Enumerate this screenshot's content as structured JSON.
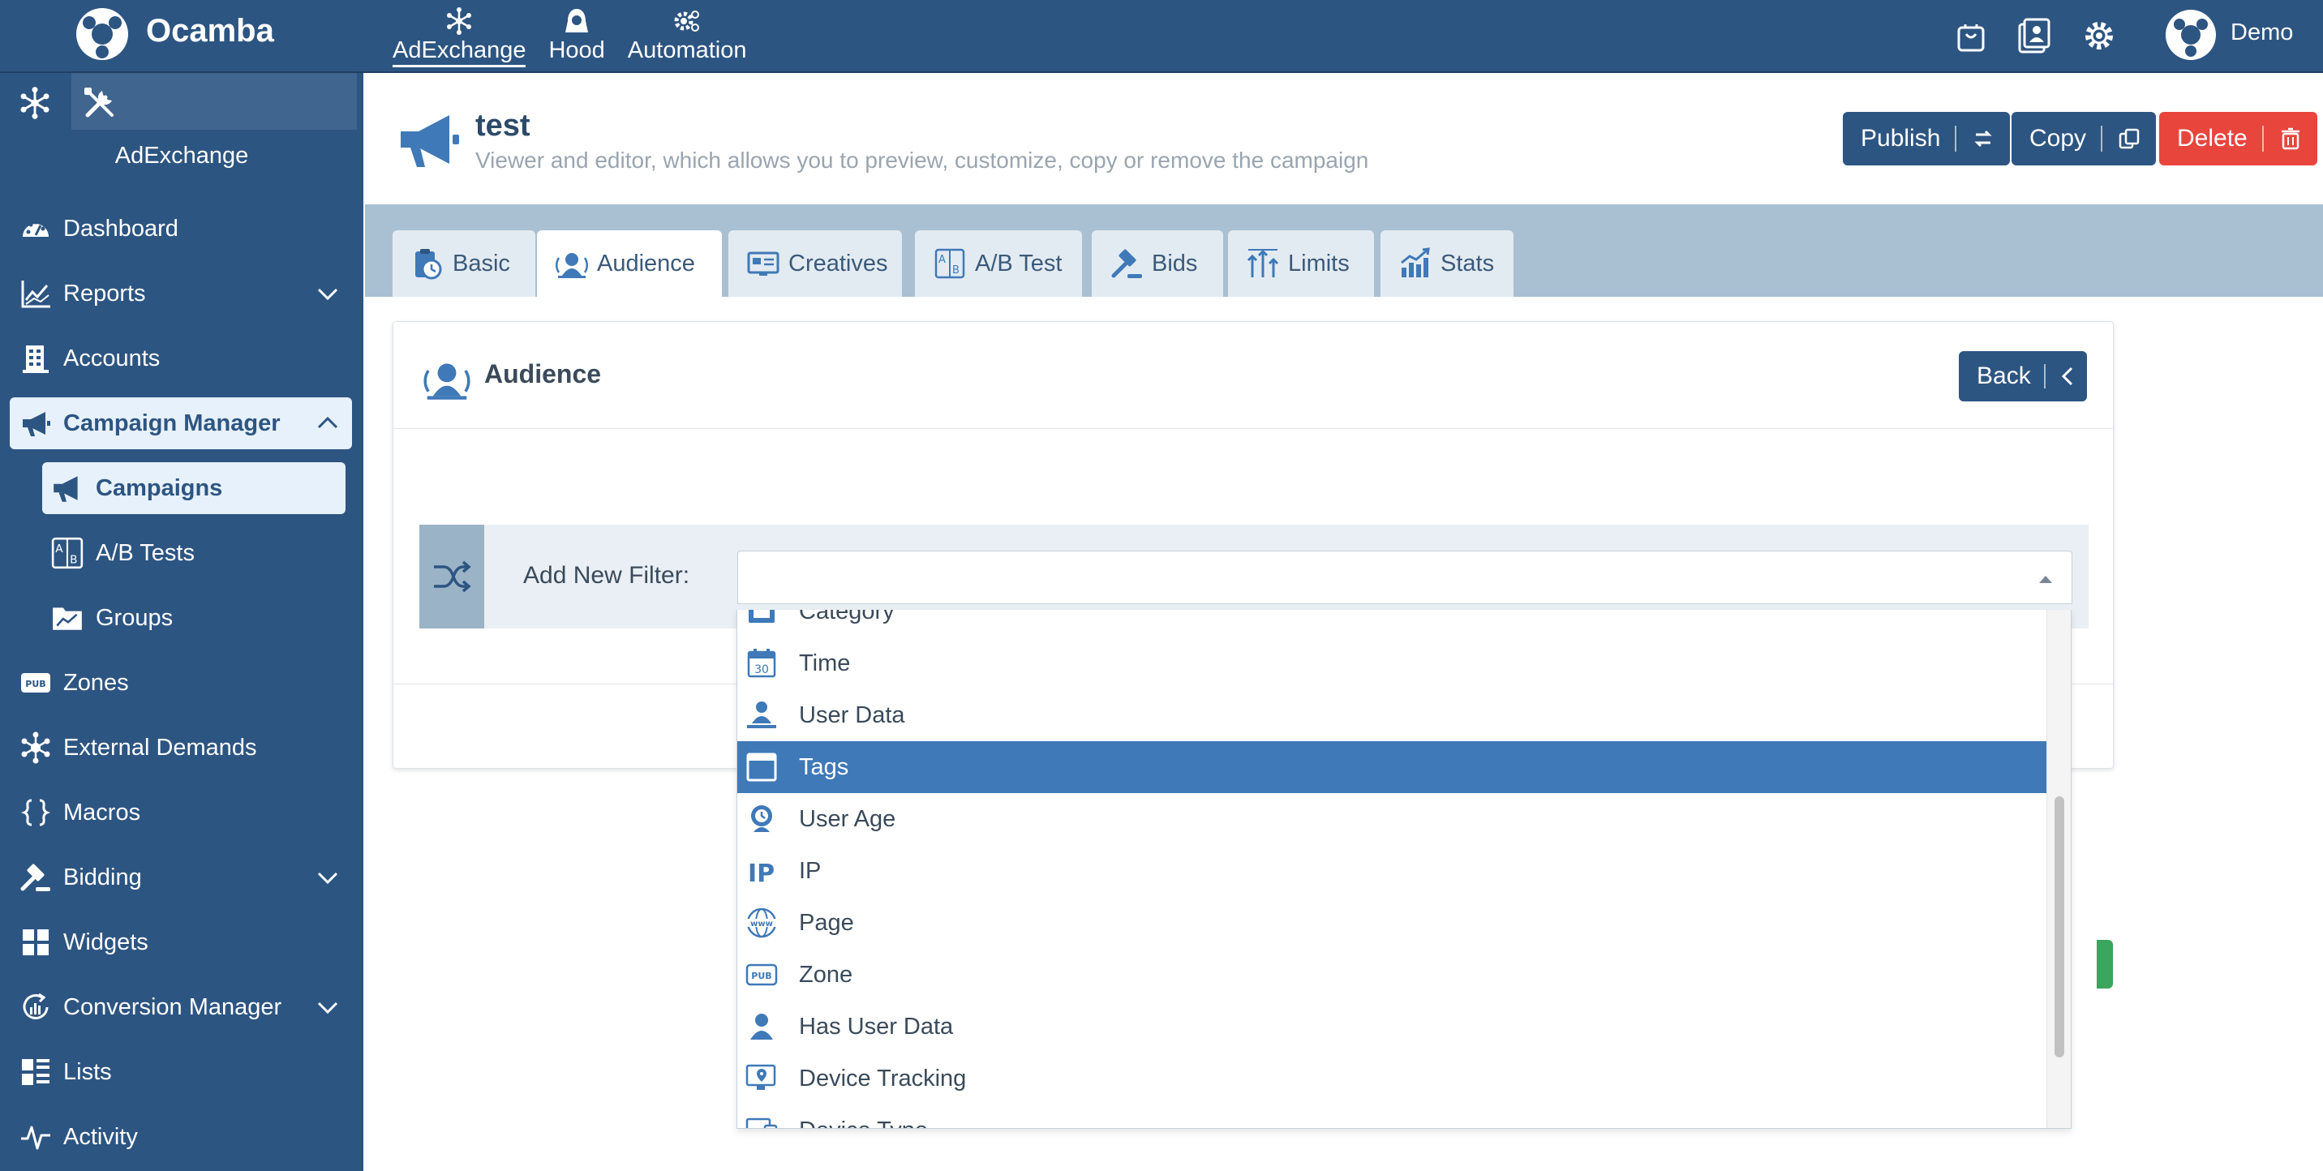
{
  "brand": {
    "name": "Ocamba"
  },
  "topnav": [
    {
      "label": "AdExchange",
      "icon": "snowflake-icon",
      "active": true
    },
    {
      "label": "Hood",
      "icon": "hooded-figure-icon",
      "active": false
    },
    {
      "label": "Automation",
      "icon": "gears-icon",
      "active": false
    }
  ],
  "topbar": {
    "user_name": "Demo"
  },
  "sidebar": {
    "title": "AdExchange",
    "items": [
      {
        "label": "Dashboard",
        "icon": "dashboard-gauge-icon"
      },
      {
        "label": "Reports",
        "icon": "chart-line-icon"
      },
      {
        "label": "Accounts",
        "icon": "building-icon"
      },
      {
        "label": "Campaign Manager",
        "icon": "megaphone-icon"
      },
      {
        "label": "Zones",
        "icon": "pub-badge-icon"
      },
      {
        "label": "External Demands",
        "icon": "network-icon"
      },
      {
        "label": "Macros",
        "icon": "braces-icon"
      },
      {
        "label": "Bidding",
        "icon": "gavel-icon"
      },
      {
        "label": "Widgets",
        "icon": "grid-icon"
      },
      {
        "label": "Conversion Manager",
        "icon": "conversion-icon"
      },
      {
        "label": "Lists",
        "icon": "list-icon"
      },
      {
        "label": "Activity",
        "icon": "pulse-icon"
      }
    ],
    "sub_items": [
      {
        "label": "Campaigns",
        "icon": "megaphone-icon",
        "active": true
      },
      {
        "label": "A/B Tests",
        "icon": "ab-test-icon",
        "active": false
      },
      {
        "label": "Groups",
        "icon": "folder-chart-icon",
        "active": false
      }
    ]
  },
  "page": {
    "title": "test",
    "subtitle": "Viewer and editor, which allows you to preview, customize, copy or remove the campaign",
    "buttons": {
      "publish": "Publish",
      "copy": "Copy",
      "delete": "Delete"
    }
  },
  "tabs": [
    {
      "label": "Basic",
      "icon": "clipboard-clock-icon"
    },
    {
      "label": "Audience",
      "icon": "audience-icon",
      "active": true
    },
    {
      "label": "Creatives",
      "icon": "monitor-icon"
    },
    {
      "label": "A/B Test",
      "icon": "ab-test-icon"
    },
    {
      "label": "Bids",
      "icon": "gavel-icon"
    },
    {
      "label": "Limits",
      "icon": "limits-arrows-icon"
    },
    {
      "label": "Stats",
      "icon": "stats-chart-icon"
    }
  ],
  "card": {
    "title": "Audience",
    "back_label": "Back",
    "filter_label": "Add New Filter:"
  },
  "dropdown": {
    "items": [
      {
        "label": "Category",
        "icon": "category-icon"
      },
      {
        "label": "Time",
        "icon": "calendar-30-icon"
      },
      {
        "label": "User Data",
        "icon": "user-data-icon"
      },
      {
        "label": "Tags",
        "icon": "window-icon",
        "selected": true
      },
      {
        "label": "User Age",
        "icon": "user-age-icon"
      },
      {
        "label": "IP",
        "icon": "ip-icon"
      },
      {
        "label": "Page",
        "icon": "www-globe-icon"
      },
      {
        "label": "Zone",
        "icon": "pub-badge-icon"
      },
      {
        "label": "Has User Data",
        "icon": "user-icon"
      },
      {
        "label": "Device Tracking",
        "icon": "device-tracking-icon"
      },
      {
        "label": "Device Type",
        "icon": "device-type-icon"
      }
    ]
  },
  "colors": {
    "primary": "#2d5582",
    "selected": "#3f79b8",
    "danger": "#e8453c",
    "tab_band": "#a9c0d3"
  }
}
